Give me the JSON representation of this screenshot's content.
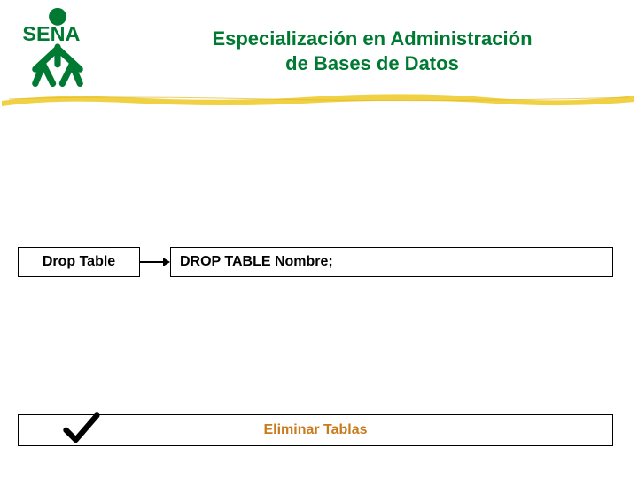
{
  "header": {
    "logo_text": "SENA",
    "title_line1": "Especialización en Administración",
    "title_line2": "de Bases de Datos"
  },
  "left_box": {
    "label": "Drop Table"
  },
  "right_box": {
    "text": "DROP TABLE Nombre;"
  },
  "bottom": {
    "text": "Eliminar Tablas"
  },
  "colors": {
    "sena_green": "#007a33",
    "brush_yellow": "#f0cf3a",
    "bottom_orange": "#c97a1b"
  }
}
